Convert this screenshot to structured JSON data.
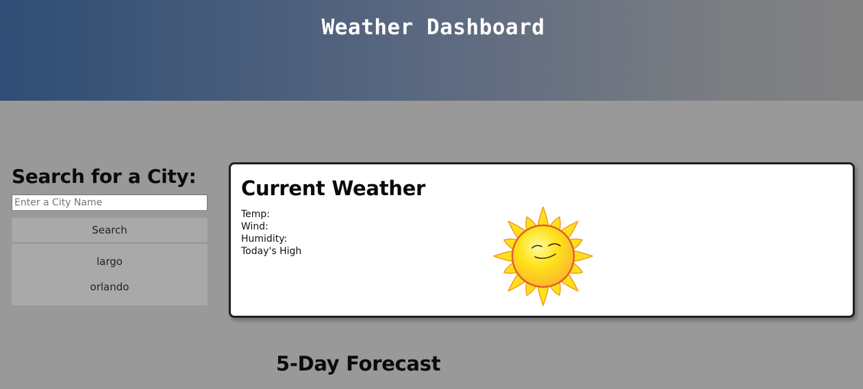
{
  "header": {
    "title": "Weather Dashboard"
  },
  "sidebar": {
    "heading": "Search for a City:",
    "search_placeholder": "Enter a City Name",
    "search_value": "",
    "search_button_label": "Search",
    "history": [
      {
        "label": "largo"
      },
      {
        "label": "orlando"
      }
    ]
  },
  "current": {
    "title": "Current Weather",
    "temp_label": "Temp:",
    "wind_label": "Wind:",
    "humidity_label": "Humidity:",
    "high_label": "Today's High",
    "icon": "smiling-sun-icon"
  },
  "forecast": {
    "title": "5-Day Forecast"
  },
  "colors": {
    "page_background": "#999999",
    "header_gradient_start": "#2f4d75",
    "header_gradient_end": "#828282",
    "card_background": "#ffffff",
    "card_border": "#1f1f1f",
    "button_background": "#a9a9a9",
    "sun_yellow": "#ffe11a",
    "sun_orange": "#f39a1e"
  }
}
